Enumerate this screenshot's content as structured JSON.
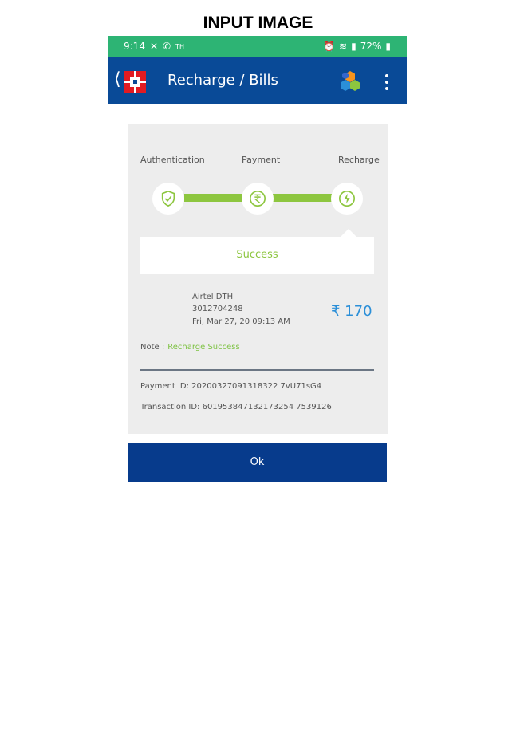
{
  "caption": "INPUT IMAGE",
  "status_bar": {
    "time": "9:14",
    "left_extra": "TH",
    "battery": "72%",
    "colors": {
      "background": "#2db474"
    }
  },
  "app_bar": {
    "title": "Recharge / Bills",
    "back_icon": "chevron-left-icon",
    "logo": "hdfc-logo",
    "app_icon": "hexagon-cluster-icon",
    "menu_icon": "more-vertical-icon",
    "colors": {
      "background": "#094a97"
    }
  },
  "progress": {
    "steps": [
      {
        "label": "Authentication",
        "icon": "shield-check-icon"
      },
      {
        "label": "Payment",
        "icon": "rupee-icon"
      },
      {
        "label": "Recharge",
        "icon": "lightning-icon"
      }
    ],
    "colors": {
      "line": "#8dc63f"
    }
  },
  "status_message": "Success",
  "transaction": {
    "biller": "Airtel DTH",
    "account": "3012704248",
    "datetime": "Fri, Mar 27, 20 09:13 AM",
    "amount": "₹ 170",
    "note_label": "Note :",
    "note_value": "Recharge Success",
    "payment_id": "Payment ID: 20200327091318322 7vU71sG4",
    "transaction_id": "Transaction ID: 601953847132173254 7539126"
  },
  "ok_button": {
    "label": "Ok",
    "color": "#073b8c"
  }
}
